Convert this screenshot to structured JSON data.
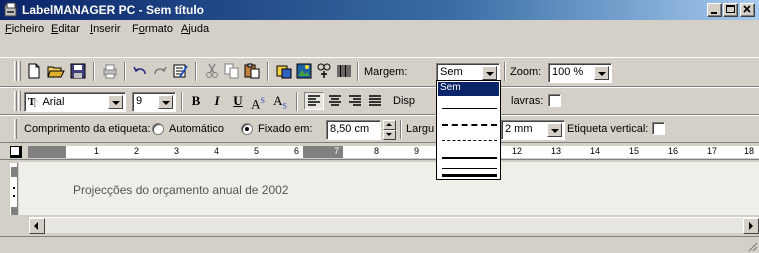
{
  "window": {
    "title": "LabelMANAGER PC - Sem título"
  },
  "menu": {
    "items": [
      "Ficheiro",
      "Editar",
      "Inserir",
      "Formato",
      "Ajuda"
    ],
    "mnemonics": [
      "F",
      "E",
      "I",
      "o",
      "A"
    ]
  },
  "toolbar": {
    "margin_label": "Margem:",
    "margin_value": "Sem",
    "zoom_label": "Zoom:",
    "zoom_value": "100 %"
  },
  "format_bar": {
    "font_value": "Arial",
    "size_value": "9",
    "bold": "B",
    "italic": "I",
    "underline": "U",
    "superscript": "A",
    "superscript_mark": "S",
    "subscript": "A",
    "subscript_mark": "S",
    "display_label_partial": "Disp",
    "words_label_partial": "lavras:"
  },
  "label_bar": {
    "length_label": "Comprimento da etiqueta:",
    "auto_label": "Automático",
    "fixed_label": "Fixado em:",
    "fixed_value": "8,50 cm",
    "width_label_partial": "Largu",
    "width_value_partial": "2 mm",
    "vertical_label": "Etiqueta vertical:",
    "auto_selected": false,
    "fixed_selected": true
  },
  "margin_dropdown": {
    "selected": "Sem",
    "option_count": 6
  },
  "ruler": {
    "labels": [
      "1",
      "2",
      "3",
      "4",
      "5",
      "6",
      "7",
      "8",
      "9",
      "12",
      "13",
      "14",
      "15",
      "16",
      "17",
      "18"
    ]
  },
  "document": {
    "text": "Projecções do orçamento anual de 2002"
  },
  "colors": {
    "title_start": "#0a246a",
    "title_end": "#a6caf0",
    "selection": "#0a246a",
    "face": "#d4d0c8"
  }
}
